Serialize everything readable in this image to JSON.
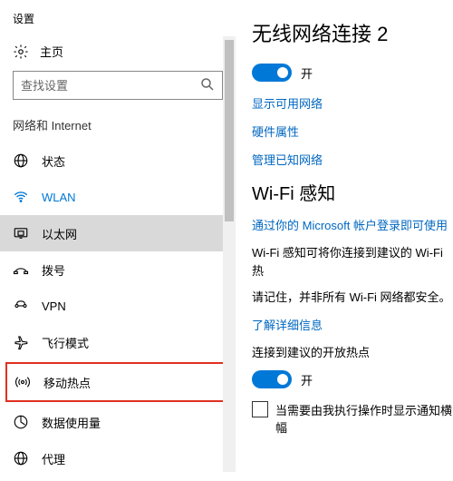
{
  "app_title": "设置",
  "home_label": "主页",
  "search_placeholder": "查找设置",
  "section_label": "网络和 Internet",
  "nav": [
    {
      "id": "status",
      "label": "状态"
    },
    {
      "id": "wlan",
      "label": "WLAN"
    },
    {
      "id": "ethernet",
      "label": "以太网"
    },
    {
      "id": "dialup",
      "label": "拨号"
    },
    {
      "id": "vpn",
      "label": "VPN"
    },
    {
      "id": "airplane",
      "label": "飞行模式"
    },
    {
      "id": "hotspot",
      "label": "移动热点"
    },
    {
      "id": "datausage",
      "label": "数据使用量"
    },
    {
      "id": "proxy",
      "label": "代理"
    }
  ],
  "main": {
    "title": "无线网络连接 2",
    "toggle1_state": "开",
    "link_show_networks": "显示可用网络",
    "link_hw_props": "硬件属性",
    "link_manage_known": "管理已知网络",
    "wifi_sense_title": "Wi-Fi 感知",
    "link_ms_login": "通过你的 Microsoft 帐户登录即可使用",
    "sense_desc1": "Wi-Fi 感知可将你连接到建议的 Wi-Fi 热",
    "sense_desc2": "请记住，并非所有 Wi-Fi 网络都安全。",
    "link_learn_more": "了解详细信息",
    "open_hotspot_label": "连接到建议的开放热点",
    "toggle2_state": "开",
    "checkbox_label": "当需要由我执行操作时显示通知横幅"
  }
}
